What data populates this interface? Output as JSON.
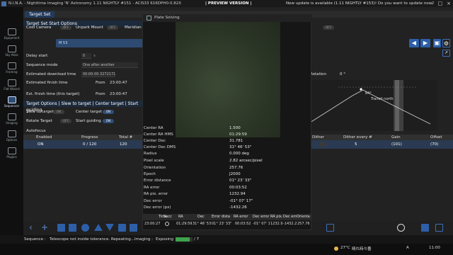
{
  "titlebar": {
    "title": "N.I.N.A. - Nighttime Imaging 'N' Astronomy 1.11 NIGHTLY #151 - ACIS33 616DPH0-0.82X",
    "preview": "| PREVIEW VERSION |",
    "update": "New update is available (1.11 NIGHTLY #153)! Do you want to update now?",
    "minimize": "–",
    "maximize": "□",
    "close": "×"
  },
  "rail": [
    {
      "label": "Equipment",
      "icon": "equipment-icon"
    },
    {
      "label": "Sky Atlas",
      "icon": "sky-atlas-icon"
    },
    {
      "label": "Framing",
      "icon": "framing-icon"
    },
    {
      "label": "Flat Wizard",
      "icon": "flat-wizard-icon"
    },
    {
      "label": "Sequencer",
      "icon": "sequencer-icon"
    },
    {
      "label": "Imaging",
      "icon": "imaging-icon"
    },
    {
      "label": "Options",
      "icon": "options-icon"
    },
    {
      "label": "Plugins",
      "icon": "plugins-icon"
    }
  ],
  "main": {
    "tab": "Target Set",
    "start_options_header": "Target Set Start Options",
    "cool_camera": "Cool Camera",
    "cool_camera_state": "OFF",
    "unpark_mount": "Unpark Mount",
    "unpark_state": "OFF",
    "meridian": "Meridian",
    "meridian_state": "OFF",
    "target_name": "M 53",
    "delay_start": "Delay start",
    "delay_val": "0",
    "delay_unit": "s",
    "sequence_mode": "Sequence mode",
    "sequence_mode_val": "One after another",
    "est_download": "Estimated download time",
    "est_download_val": "00:00:00.3272171",
    "est_finish": "Estimated finish time",
    "from1": "From",
    "est_finish_val": "23:00:47",
    "est_finish_target": "Est. finish time (this target)",
    "from2": "From",
    "est_finish_target_val": "23:00:47",
    "target_options_header": "Target Options | Slew to target | Center target | Start guiding",
    "slew": "Slew to target",
    "slew_state": "ON",
    "center": "Center target",
    "center_state": "ON",
    "rotate": "Rotate Target",
    "rotate_state": "OFF",
    "start_guiding": "Start guiding",
    "start_guiding_state": "ON",
    "autofocus": "Autofocus",
    "rotation_label": "Rotation",
    "rotation_val": "0 °",
    "transit_label": "Transit north",
    "transit_angle": "84°"
  },
  "table": {
    "headers": [
      "Enabled",
      "Progress",
      "Total #",
      "Dither",
      "Dither every #",
      "Gain",
      "Offset"
    ],
    "row": [
      "ON",
      "0 / 120",
      "120",
      "",
      "5",
      "(101)",
      "(70)"
    ]
  },
  "status": {
    "sequence": "Sequence :",
    "sequence_msg": "Telescope not inside tolerance. Repeating...",
    "imaging": "Imaging :",
    "exposing": "Exposing",
    "progress_text": "/ 7",
    "progress_fraction": 0.85
  },
  "taskbar": {
    "weather": "27°C",
    "weather_desc": "晴れ時々曇",
    "lang": "A",
    "time": "11:00"
  },
  "dialog": {
    "title": "Plate Solving",
    "props": [
      {
        "k": "Center RA",
        "v": "1.500"
      },
      {
        "k": "Center RA HMS",
        "v": "01:29:59"
      },
      {
        "k": "Center Dec",
        "v": "31.781"
      },
      {
        "k": "Center Dec DMS",
        "v": "31° 46' 53\""
      },
      {
        "k": "Radius",
        "v": "0.000 deg"
      },
      {
        "k": "Pixel scale",
        "v": "2.82 arcsec/pixel"
      },
      {
        "k": "Orientation",
        "v": "257.76"
      },
      {
        "k": "Epoch",
        "v": "J2000"
      },
      {
        "k": "Error distance",
        "v": "01° 23' 33\""
      },
      {
        "k": "RA error",
        "v": "00:03:52"
      },
      {
        "k": "RA pix. error",
        "v": "1232.94"
      },
      {
        "k": "Dec error",
        "v": "-01° 07' 17\""
      },
      {
        "k": "Dec error (px)",
        "v": "-1432.26"
      }
    ],
    "table_headers": [
      "Time",
      "Succ",
      "RA",
      "Dec",
      "Error dista",
      "RA error",
      "Dec error",
      "RA pix.",
      "Dec error",
      "Orienta"
    ],
    "table_row": [
      "23:00:27",
      "",
      "01:29:59",
      "31° 46' 53\"",
      "01° 23' 33\"",
      "00:03:52",
      "-01° 07' 1",
      "1232.94",
      "-1432.26",
      "257.76"
    ]
  }
}
